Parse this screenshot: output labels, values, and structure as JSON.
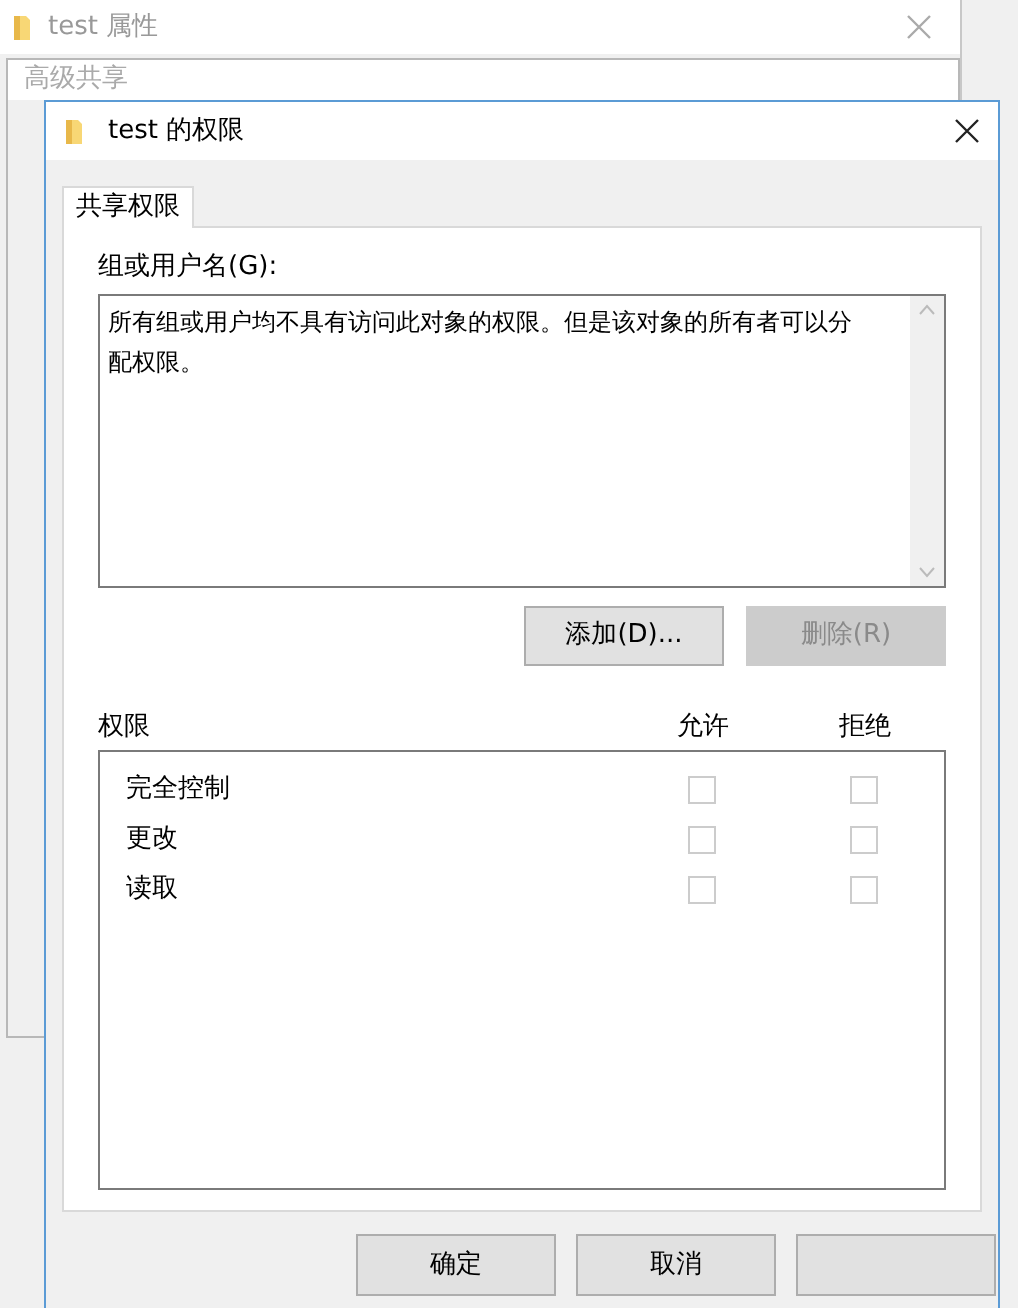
{
  "background_windows": [
    {
      "title": "test 属性"
    },
    {
      "title": "高级共享"
    }
  ],
  "dialog": {
    "title": "test 的权限",
    "tabs": [
      {
        "label": "共享权限",
        "selected": true
      }
    ],
    "group_label": "组或用户名(G):",
    "group_message": "所有组或用户均不具有访问此对象的权限。但是该对象的所有者可以分配权限。",
    "group_buttons": [
      {
        "label": "添加(D)...",
        "disabled": false
      },
      {
        "label": "删除(R)",
        "disabled": true
      }
    ],
    "permissions": {
      "label": "权限",
      "columns": [
        "允许",
        "拒绝"
      ],
      "rows": [
        {
          "name": "完全控制",
          "allow": {
            "checked": false,
            "disabled": true
          },
          "deny": {
            "checked": false,
            "disabled": true
          }
        },
        {
          "name": "更改",
          "allow": {
            "checked": false,
            "disabled": true
          },
          "deny": {
            "checked": false,
            "disabled": true
          }
        },
        {
          "name": "读取",
          "allow": {
            "checked": false,
            "disabled": true
          },
          "deny": {
            "checked": false,
            "disabled": true
          }
        }
      ]
    },
    "buttons": [
      {
        "label": "确定"
      },
      {
        "label": "取消"
      },
      {
        "kind": "blank"
      }
    ]
  }
}
